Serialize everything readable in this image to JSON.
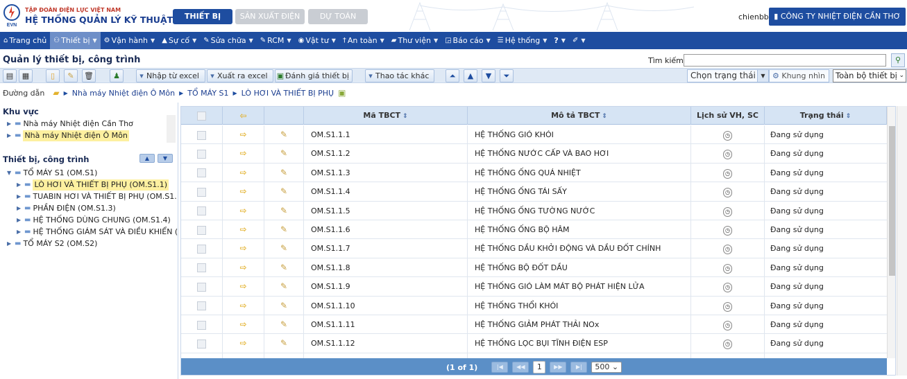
{
  "header": {
    "logo_text": "EVN",
    "org_small": "TẬP ĐOÀN ĐIỆN LỰC VIỆT NAM",
    "org_big": "HỆ THỐNG QUẢN LÝ KỸ THUẬT",
    "tabs": [
      {
        "label": "THIẾT BỊ",
        "active": true
      },
      {
        "label": "SẢN XUẤT ĐIỆN",
        "active": false
      },
      {
        "label": "DỰ TOÁN",
        "active": false
      }
    ],
    "user": "chienbb",
    "company": "CÔNG TY NHIỆT ĐIỆN CẦN THƠ",
    "colors": {
      "brand": "#1e4da0",
      "highlight": "#fdf0a0"
    }
  },
  "menu": [
    {
      "label": "Trang chủ",
      "icon": "home-icon",
      "active": false
    },
    {
      "label": "Thiết bị",
      "icon": "users-icon",
      "active": true
    },
    {
      "label": "Vận hành",
      "icon": "gears-icon",
      "active": false
    },
    {
      "label": "Sự cố",
      "icon": "warning-icon",
      "active": false
    },
    {
      "label": "Sửa chữa",
      "icon": "wrench-icon",
      "active": false
    },
    {
      "label": "RCM",
      "icon": "wrench-icon",
      "active": false
    },
    {
      "label": "Vật tư",
      "icon": "globe-icon",
      "active": false
    },
    {
      "label": "An toàn",
      "icon": "person-icon",
      "active": false
    },
    {
      "label": "Thư viện",
      "icon": "book-icon",
      "active": false
    },
    {
      "label": "Báo cáo",
      "icon": "chart-icon",
      "active": false
    },
    {
      "label": "Hệ thống",
      "icon": "list-icon",
      "active": false
    },
    {
      "label": "?",
      "icon": "",
      "active": false
    },
    {
      "label": "",
      "icon": "brush-icon",
      "active": false
    }
  ],
  "page": {
    "title": "Quản lý thiết bị, công trình",
    "search_label": "Tìm kiếm",
    "search_value": ""
  },
  "toolbar": {
    "import_label": "Nhập từ excel",
    "export_label": "Xuất ra excel",
    "evaluate_label": "Đánh giá thiết bị",
    "other_label": "Thao tác khác",
    "status_select": "Chọn trạng thái",
    "view_label": "Khung nhìn",
    "scope_select": "Toàn bộ thiết bị"
  },
  "breadcrumb": {
    "label": "Đường dẫn",
    "items": [
      "Nhà máy Nhiệt điện Ô Môn",
      "TỔ MÁY S1",
      "LÒ HƠI VÀ THIẾT BỊ PHỤ"
    ]
  },
  "left": {
    "area_title": "Khu vực",
    "areas": [
      {
        "label": "Nhà máy Nhiệt điện Cần Thơ",
        "selected": false
      },
      {
        "label": "Nhà máy Nhiệt điện Ô Môn",
        "selected": true
      }
    ],
    "equip_title": "Thiết bị, công trình",
    "tree": [
      {
        "label": "TỔ MÁY S1 (OM.S1)",
        "level": 0,
        "open": true,
        "selected": false
      },
      {
        "label": "LÒ HƠI VÀ THIẾT BỊ PHỤ (OM.S1.1)",
        "level": 1,
        "open": false,
        "selected": true
      },
      {
        "label": "TUABIN HƠI VÀ THIẾT BỊ PHỤ (OM.S1.",
        "level": 1,
        "open": false,
        "selected": false
      },
      {
        "label": "PHẦN ĐIỆN (OM.S1.3)",
        "level": 1,
        "open": false,
        "selected": false
      },
      {
        "label": "HỆ THỐNG DÙNG CHUNG (OM.S1.4)",
        "level": 1,
        "open": false,
        "selected": false
      },
      {
        "label": "HỆ THỐNG GIÁM SÁT VÀ ĐIỀU KHIỂN (",
        "level": 1,
        "open": false,
        "selected": false
      },
      {
        "label": "TỔ MÁY S2 (OM.S2)",
        "level": 0,
        "open": false,
        "selected": false
      }
    ]
  },
  "grid": {
    "columns": [
      "Mã TBCT",
      "Mô tả TBCT",
      "Lịch sử VH, SC",
      "Trạng thái"
    ],
    "rows": [
      {
        "code": "OM.S1.1.1",
        "desc": "HỆ THỐNG GIÓ KHÓI",
        "status": "Đang sử dụng"
      },
      {
        "code": "OM.S1.1.2",
        "desc": "HỆ THỐNG NƯỚC CẤP VÀ BAO HƠI",
        "status": "Đang sử dụng"
      },
      {
        "code": "OM.S1.1.3",
        "desc": "HỆ THỐNG ỐNG QUÁ NHIỆT",
        "status": "Đang sử dụng"
      },
      {
        "code": "OM.S1.1.4",
        "desc": "HỆ THỐNG ỐNG TÁI SẤY",
        "status": "Đang sử dụng"
      },
      {
        "code": "OM.S1.1.5",
        "desc": "HỆ THỐNG ỐNG TƯỜNG NƯỚC",
        "status": "Đang sử dụng"
      },
      {
        "code": "OM.S1.1.6",
        "desc": "HỆ THỐNG ỐNG BỘ HÂM",
        "status": "Đang sử dụng"
      },
      {
        "code": "OM.S1.1.7",
        "desc": "HỆ THỐNG DẦU KHỞI ĐỘNG VÀ DẦU ĐỐT CHÍNH",
        "status": "Đang sử dụng"
      },
      {
        "code": "OM.S1.1.8",
        "desc": "HỆ THỐNG BỘ ĐỐT DẦU",
        "status": "Đang sử dụng"
      },
      {
        "code": "OM.S1.1.9",
        "desc": "HỆ THỐNG GIÓ LÀM MÁT BỘ PHÁT HIỆN LỬA",
        "status": "Đang sử dụng"
      },
      {
        "code": "OM.S1.1.10",
        "desc": "HỆ THỐNG THỔI KHÓI",
        "status": "Đang sử dụng"
      },
      {
        "code": "OM.S1.1.11",
        "desc": "HỆ THỐNG GIẢM PHÁT THẢI NOx",
        "status": "Đang sử dụng"
      },
      {
        "code": "OM.S1.1.12",
        "desc": "HỆ THỐNG LỌC BỤI TĨNH ĐIỆN ESP",
        "status": "Đang sử dụng"
      },
      {
        "code": "",
        "desc": "",
        "status": ""
      }
    ],
    "pager": {
      "info": "(1 of 1)",
      "current": "1",
      "page_size": "500"
    }
  }
}
